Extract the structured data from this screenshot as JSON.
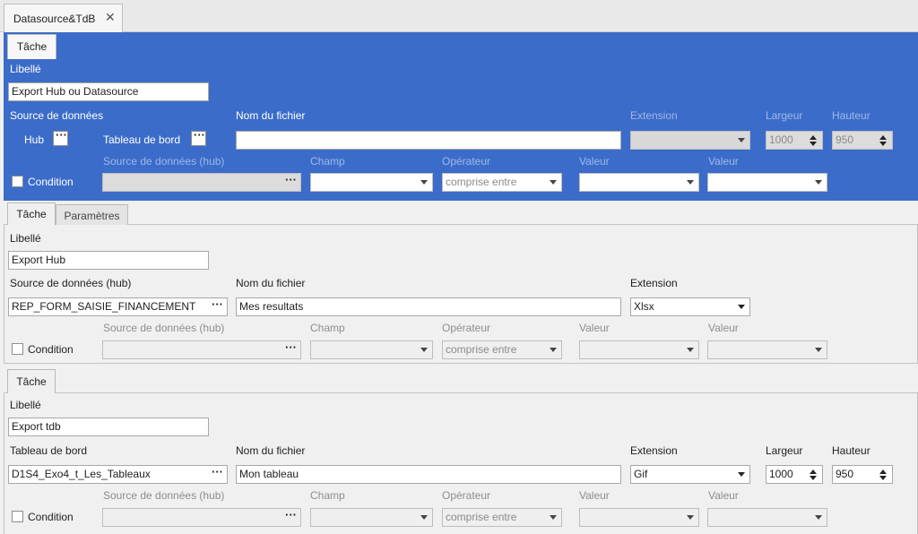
{
  "document_tab": {
    "label": "Datasource&TdB",
    "close": "✕"
  },
  "task1": {
    "tab": "Tâche",
    "libelle_label": "Libellé",
    "libelle_value": "Export Hub ou Datasource",
    "source_label": "Source de données",
    "hub_label": "Hub",
    "tableau_label": "Tableau de bord",
    "nom_label": "Nom du fichier",
    "nom_value": "",
    "extension_label": "Extension",
    "extension_value": "",
    "largeur_label": "Largeur",
    "largeur_value": "1000",
    "hauteur_label": "Hauteur",
    "hauteur_value": "950",
    "cond_source_label": "Source de données (hub)",
    "champ_label": "Champ",
    "operateur_label": "Opérateur",
    "operateur_value": "comprise entre",
    "valeur1_label": "Valeur",
    "valeur2_label": "Valeur",
    "condition_label": "Condition"
  },
  "task2": {
    "tabs": [
      "Tâche",
      "Paramètres"
    ],
    "libelle_label": "Libellé",
    "libelle_value": "Export Hub",
    "source_label": "Source de données (hub)",
    "source_value": "REP_FORM_SAISIE_FINANCEMENT",
    "nom_label": "Nom du fichier",
    "nom_value": "Mes resultats",
    "extension_label": "Extension",
    "extension_value": "Xlsx",
    "cond_source_label": "Source de données (hub)",
    "champ_label": "Champ",
    "operateur_label": "Opérateur",
    "operateur_value": "comprise entre",
    "valeur1_label": "Valeur",
    "valeur2_label": "Valeur",
    "condition_label": "Condition"
  },
  "task3": {
    "tab": "Tâche",
    "libelle_label": "Libellé",
    "libelle_value": "Export tdb",
    "tableau_label": "Tableau de bord",
    "tableau_value": "D1S4_Exo4_t_Les_Tableaux",
    "nom_label": "Nom du fichier",
    "nom_value": "Mon tableau",
    "extension_label": "Extension",
    "extension_value": "Gif",
    "largeur_label": "Largeur",
    "largeur_value": "1000",
    "hauteur_label": "Hauteur",
    "hauteur_value": "950",
    "cond_source_label": "Source de données (hub)",
    "champ_label": "Champ",
    "operateur_label": "Opérateur",
    "operateur_value": "comprise entre",
    "valeur1_label": "Valeur",
    "valeur2_label": "Valeur",
    "condition_label": "Condition"
  },
  "ellipsis": "···",
  "colors": {
    "selected_panel": "#3b6cc9",
    "panel_bg": "#f0f0f0"
  }
}
